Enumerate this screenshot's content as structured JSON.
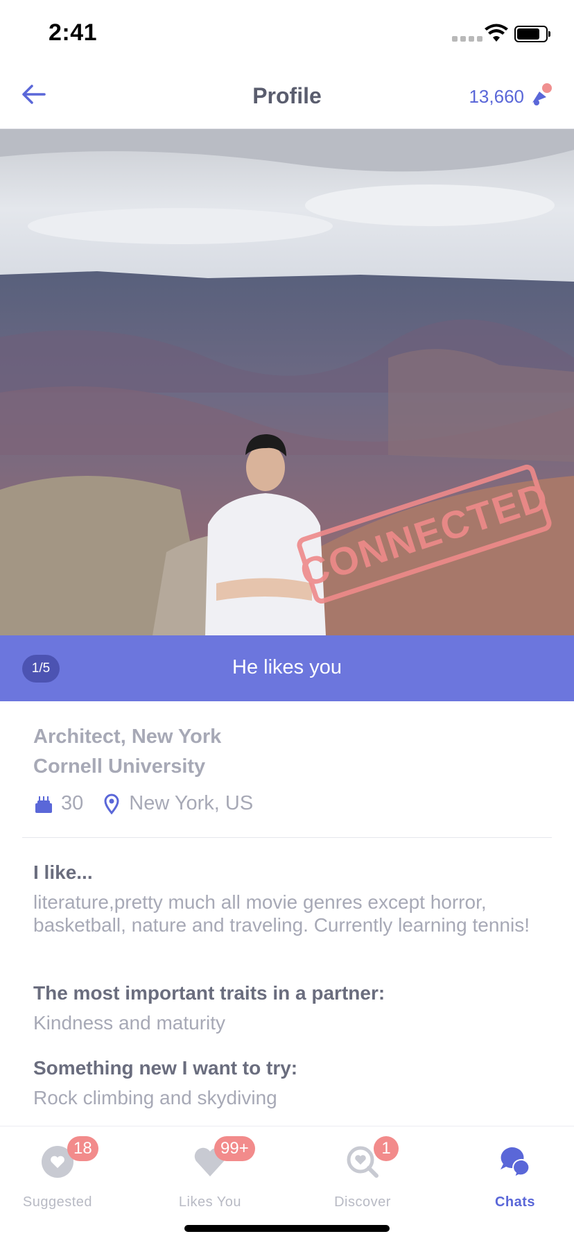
{
  "status_bar": {
    "time": "2:41"
  },
  "header": {
    "title": "Profile",
    "coins": "13,660"
  },
  "photo": {
    "stamp": "CONNECTED",
    "counter": "1/5",
    "likes_text": "He likes you"
  },
  "profile": {
    "occupation": "Architect, New York",
    "school": "Cornell University",
    "age": "30",
    "location": "New York, US",
    "prompts": [
      {
        "question": "I like...",
        "answer": "literature,pretty much all movie genres except horror, basketball, nature and traveling. Currently learning tennis!"
      },
      {
        "question": "The most important traits in a partner:",
        "answer": "Kindness and maturity"
      },
      {
        "question": "Something new I want to try:",
        "answer": "Rock climbing and skydiving"
      }
    ]
  },
  "tabs": [
    {
      "label": "Suggested",
      "badge": "18",
      "icon": "heart-bubble-icon"
    },
    {
      "label": "Likes You",
      "badge": "99+",
      "icon": "heart-icon"
    },
    {
      "label": "Discover",
      "badge": "1",
      "icon": "search-heart-icon"
    },
    {
      "label": "Chats",
      "badge": "",
      "icon": "chat-bubbles-icon"
    }
  ],
  "colors": {
    "accent": "#5a67d8",
    "badge": "#f28b8b",
    "likes_bar": "#606ada"
  }
}
